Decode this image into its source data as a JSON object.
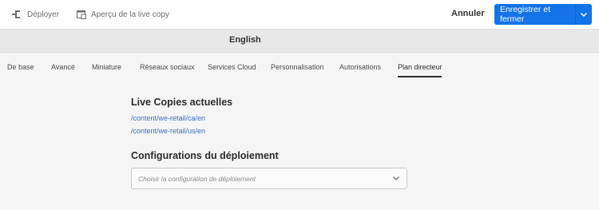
{
  "toolbar": {
    "deploy_label": "Déployer",
    "preview_label": "Aperçu de la live copy",
    "cancel_label": "Annuler",
    "save_label": "Enregistrer et fermer"
  },
  "page": {
    "title": "English"
  },
  "tabs": [
    {
      "label": "De base"
    },
    {
      "label": "Avancé"
    },
    {
      "label": "Miniature"
    },
    {
      "label": "Réseaux sociaux"
    },
    {
      "label": "Services Cloud"
    },
    {
      "label": "Personnalisation"
    },
    {
      "label": "Autorisations"
    },
    {
      "label": "Plan directeur",
      "active": true
    }
  ],
  "live_copies": {
    "heading": "Live Copies actuelles",
    "links": [
      "/content/we-retail/ca/en",
      "/content/we-retail/us/en"
    ]
  },
  "rollout": {
    "heading": "Configurations du déploiement",
    "placeholder": "Choisir la configuration de déploiement"
  },
  "colors": {
    "accent": "#1473e6",
    "link": "#3b6fb6"
  },
  "icons": [
    "deploy-icon",
    "live-copy-preview-icon",
    "chevron-down-icon"
  ]
}
